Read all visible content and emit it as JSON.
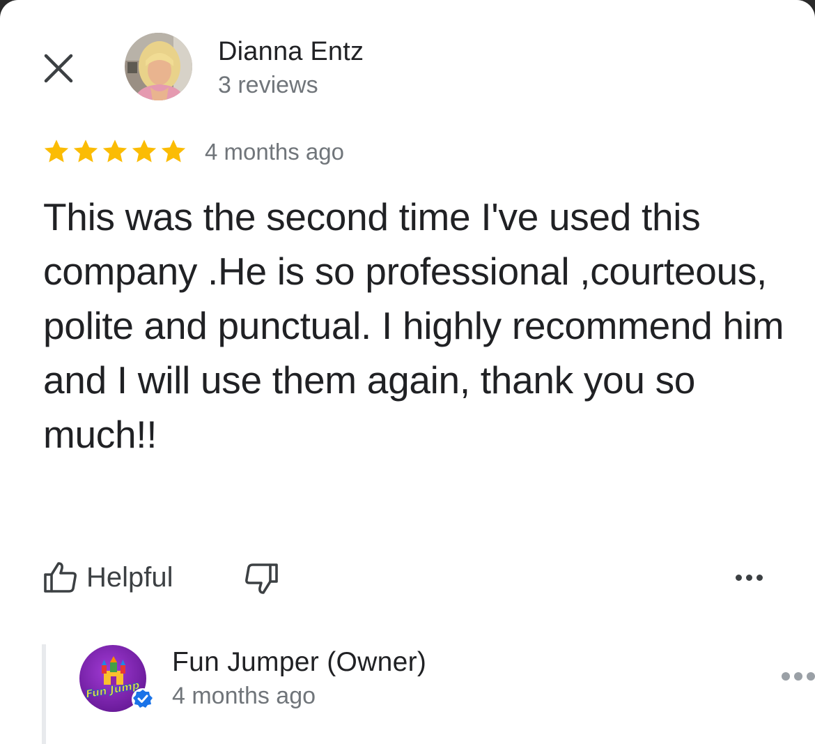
{
  "reviewer": {
    "name": "Dianna Entz",
    "meta": "3 reviews"
  },
  "review": {
    "rating": 5,
    "time": "4 months ago",
    "text": "This was the second time I've used this company .He is so professional ,courteous, polite and punctual. I highly recommend him and I will use them again, thank you so much!!"
  },
  "actions": {
    "helpful_label": "Helpful"
  },
  "owner_reply": {
    "name": "Fun Jumper (Owner)",
    "time": "4 months ago",
    "logo_text": "Fun Jump"
  },
  "colors": {
    "star": "#fbbc04",
    "text_primary": "#202124",
    "text_secondary": "#70757a",
    "owner_avatar_bg": "#7b1fa2",
    "verified_badge": "#1a73e8"
  }
}
